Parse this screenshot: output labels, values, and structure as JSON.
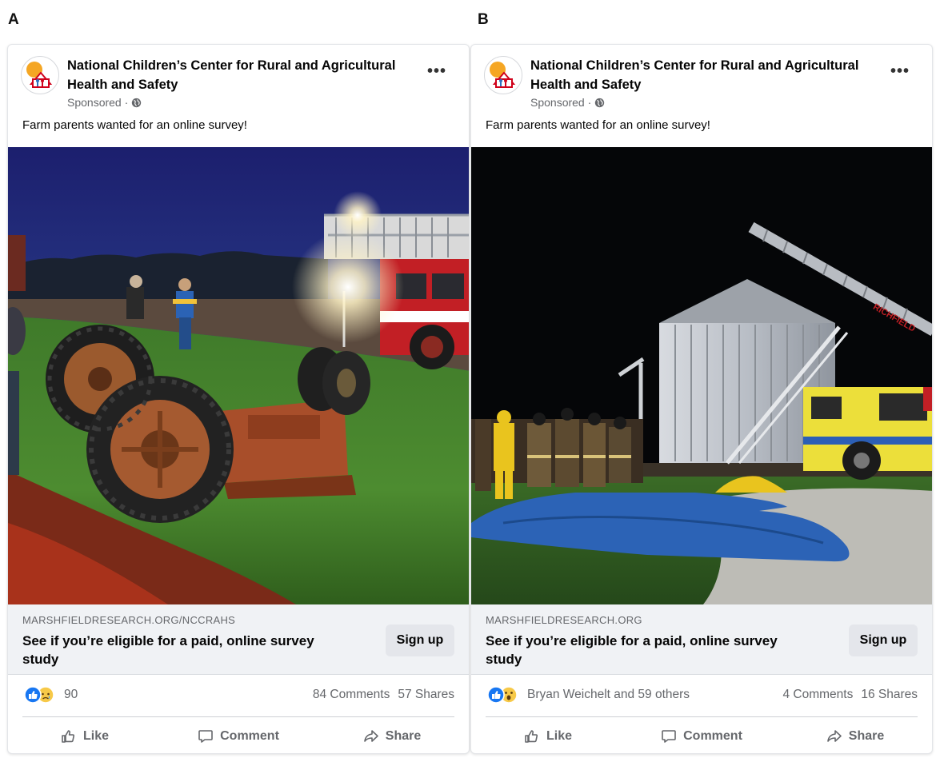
{
  "panel_a": {
    "letter": "A",
    "page_name": "National Children’s Center for Rural and Agricultural Health and Safety",
    "sponsored": "Sponsored ·",
    "post_text": "Farm parents wanted for an online survey!",
    "link_domain": "MARSHFIELDRESEARCH.ORG/NCCRAHS",
    "link_title": "See if you’re eligible for a paid, online survey study",
    "cta_label": "Sign up",
    "reaction_count": "90",
    "comments": "84 Comments",
    "shares": "57 Shares",
    "like_label": "Like",
    "comment_label": "Comment",
    "share_label": "Share"
  },
  "panel_b": {
    "letter": "B",
    "page_name": "National Children’s Center for Rural and Agricultural Health and Safety",
    "sponsored": "Sponsored ·",
    "post_text": "Farm parents wanted for an online survey!",
    "link_domain": "MARSHFIELDRESEARCH.ORG",
    "link_title": "See if you’re eligible for a paid, online survey study",
    "cta_label": "Sign up",
    "reaction_count": "Bryan Weichelt and 59 others",
    "comments": "4 Comments",
    "shares": "16 Shares",
    "like_label": "Like",
    "comment_label": "Comment",
    "share_label": "Share",
    "truck_text": "RICHFIELD"
  },
  "icons": {
    "avatar": "logo-icon",
    "globe": "globe-icon",
    "more": "more-options-icon",
    "like": "thumbs-up-icon",
    "comment": "speech-bubble-icon",
    "share": "share-arrow-icon"
  },
  "colors": {
    "facebook_blue": "#1877f2",
    "muted_text": "#65676b",
    "link_box_bg": "#f0f2f5"
  }
}
